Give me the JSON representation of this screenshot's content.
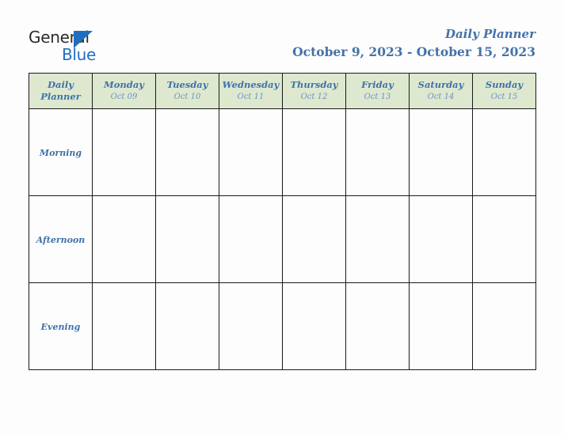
{
  "brand": {
    "name_part1": "General",
    "name_part2": "Blue",
    "triangle_color": "#1f6fc0",
    "text_color": "#2b2b2b"
  },
  "header": {
    "title": "Daily Planner",
    "date_range": "October 9, 2023 - October 15, 2023",
    "title_color": "#4472a8"
  },
  "table": {
    "corner_label_line1": "Daily",
    "corner_label_line2": "Planner",
    "header_bg": "#dde8cf",
    "row_label_bg": "#e9e9e9",
    "border_color": "#1a1a1a",
    "accent_text": "#3f72ab",
    "date_text": "#6f93c0",
    "columns": [
      {
        "day": "Monday",
        "date": "Oct 09"
      },
      {
        "day": "Tuesday",
        "date": "Oct 10"
      },
      {
        "day": "Wednesday",
        "date": "Oct 11"
      },
      {
        "day": "Thursday",
        "date": "Oct 12"
      },
      {
        "day": "Friday",
        "date": "Oct 13"
      },
      {
        "day": "Saturday",
        "date": "Oct 14"
      },
      {
        "day": "Sunday",
        "date": "Oct 15"
      }
    ],
    "rows": [
      {
        "label": "Morning",
        "cells": [
          "",
          "",
          "",
          "",
          "",
          "",
          ""
        ]
      },
      {
        "label": "Afternoon",
        "cells": [
          "",
          "",
          "",
          "",
          "",
          "",
          ""
        ]
      },
      {
        "label": "Evening",
        "cells": [
          "",
          "",
          "",
          "",
          "",
          "",
          ""
        ]
      }
    ]
  }
}
